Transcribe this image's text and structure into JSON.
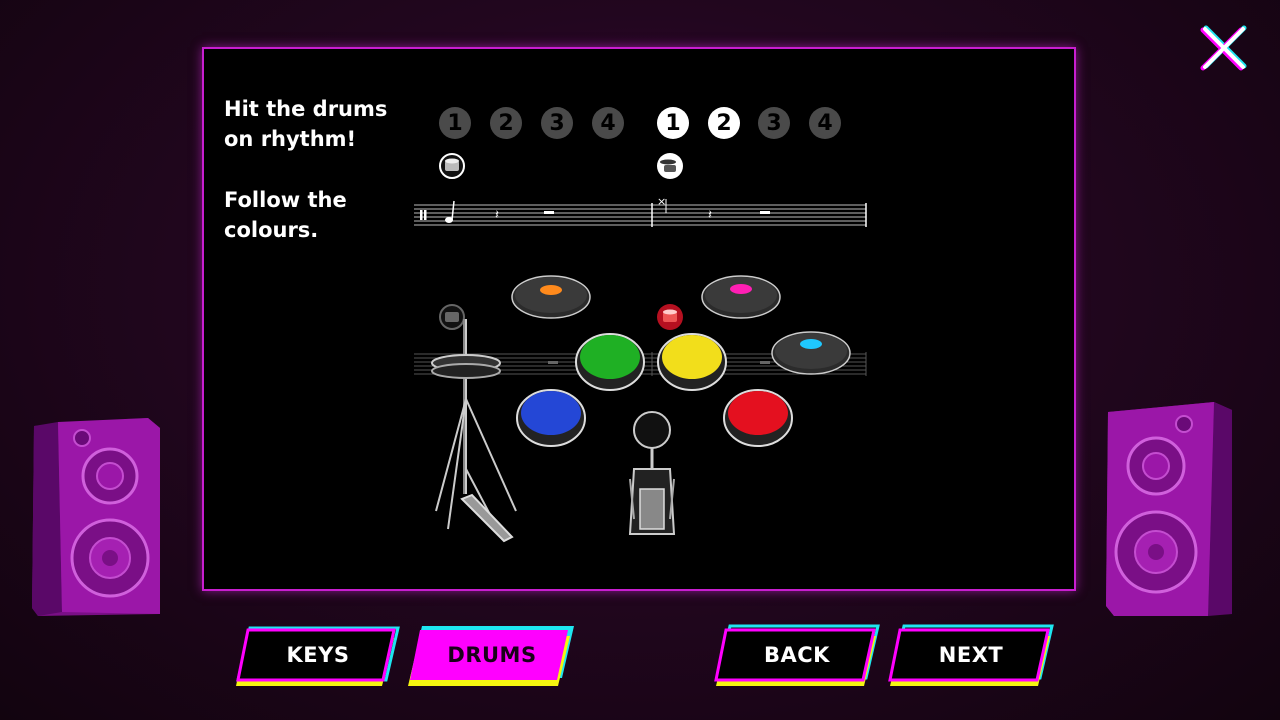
{
  "instructions": {
    "line1a": "Hit the drums",
    "line1b": "on rhythm!",
    "line2a": "Follow the",
    "line2b": "colours."
  },
  "beats": {
    "bar1": [
      "1",
      "2",
      "3",
      "4"
    ],
    "bar2": [
      "1",
      "2",
      "3",
      "4"
    ],
    "bar2_active_count": 2
  },
  "pads": {
    "colors": {
      "green": "#1fb024",
      "yellow": "#f2de1b",
      "blue": "#2447d6",
      "red": "#e4101f",
      "orange_cymbal": "#ff8a1c",
      "pink_cymbal": "#ff1fb4",
      "cyan_cymbal": "#1fc8ff"
    }
  },
  "nav": {
    "keys_label": "KEYS",
    "drums_label": "DRUMS",
    "back_label": "BACK",
    "next_label": "NEXT",
    "selected_tab": "DRUMS"
  },
  "colors": {
    "accent_magenta": "#ff00ff",
    "accent_cyan": "#1ee6f0",
    "accent_yellow": "#f5f510",
    "panel_border": "#c81ed0"
  },
  "icons": {
    "close": "close-icon",
    "drum_note": "drum-icon",
    "cymbal_note": "cymbal-icon"
  }
}
